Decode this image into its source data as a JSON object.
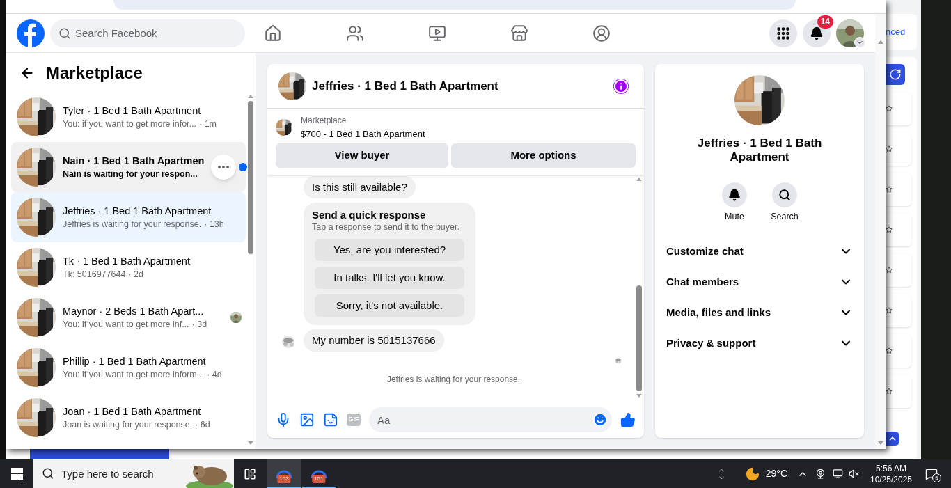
{
  "header": {
    "search": {
      "placeholder": "Search Facebook"
    },
    "notification_count": "14"
  },
  "sidebar": {
    "title": "Marketplace",
    "conversations": [
      {
        "name": "Tyler · 1 Bed 1 Bath Apartment",
        "preview": "You: if you want to get more infor...",
        "time": "· 1m",
        "selected": false,
        "hovered": false,
        "unread": false,
        "seen": false
      },
      {
        "name": "Nain · 1 Bed 1 Bath Apartmen",
        "preview": "Nain is waiting for your respon...",
        "selected": false,
        "hovered": true,
        "unread": true,
        "seen": false
      },
      {
        "name": "Jeffries · 1 Bed 1 Bath Apartment",
        "preview": "Jeffries is waiting for your response.",
        "time": "· 13h",
        "selected": true,
        "hovered": false,
        "unread": false,
        "seen": false
      },
      {
        "name": "Tk · 1 Bed 1 Bath Apartment",
        "preview": "Tk: 5016977644",
        "time": "· 2d",
        "selected": false,
        "hovered": false,
        "unread": false,
        "seen": false
      },
      {
        "name": "Maynor · 2 Beds 1 Bath Apart...",
        "preview": "You: if you want to get more inf...",
        "time": "· 3d",
        "selected": false,
        "hovered": false,
        "unread": false,
        "seen": true
      },
      {
        "name": "Phillip · 1 Bed 1 Bath Apartment",
        "preview": "You: if you want to get more inform...",
        "time": "· 4d",
        "selected": false,
        "hovered": false,
        "unread": false,
        "seen": false
      },
      {
        "name": "Joan · 1 Bed 1 Bath Apartment",
        "preview": "Joan is waiting for your response.",
        "time": "· 6d",
        "selected": false,
        "hovered": false,
        "unread": false,
        "seen": false
      }
    ]
  },
  "chat": {
    "title": "Jeffries · 1 Bed 1 Bath Apartment",
    "listing": {
      "label": "Marketplace",
      "title": "$700 - 1 Bed 1 Bath Apartment",
      "buttons": [
        "View buyer",
        "More options"
      ]
    },
    "messages": [
      {
        "kind": "text",
        "text": "Is this still available?",
        "avatar": false
      },
      {
        "kind": "quick_responses",
        "title": "Send a quick response",
        "subtitle": "Tap a response to send it to the buyer.",
        "options": [
          "Yes, are you interested?",
          "In talks. I'll let you know.",
          "Sorry, it's not available."
        ]
      },
      {
        "kind": "text",
        "text": "My number is 5015137666",
        "avatar": true
      }
    ],
    "status": "Jeffries is waiting for your response.",
    "composer": {
      "placeholder": "Aa",
      "gif_label": "GIF"
    }
  },
  "info_panel": {
    "title": "Jeffries · 1 Bed 1 Bath Apartment",
    "actions": [
      "Mute",
      "Search"
    ],
    "sections": [
      {
        "label": "Customize chat",
        "expanded": false
      },
      {
        "label": "Chat members",
        "expanded": false
      },
      {
        "label": "Media, files and links",
        "expanded": false
      },
      {
        "label": "Privacy & support",
        "expanded": false
      }
    ]
  },
  "background_window": {
    "link_text": "nced"
  },
  "taskbar": {
    "search_placeholder": "Type here to search",
    "apps": [
      {
        "badge": "153",
        "selected": true
      },
      {
        "badge": "151",
        "selected": false
      }
    ],
    "weather": "29°C",
    "time": "5:56 AM",
    "date": "10/25/2025",
    "notification_count": "5"
  }
}
